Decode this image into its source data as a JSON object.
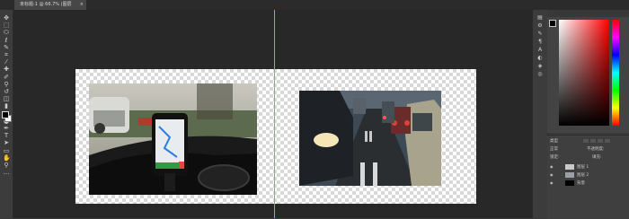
{
  "document": {
    "tab_label": "未标题-1 @ 66.7% (图层",
    "close_glyph": "×"
  },
  "tools": [
    {
      "name": "move-tool-icon",
      "glyph": "✥"
    },
    {
      "name": "artboard-tool-icon",
      "glyph": "⬚"
    },
    {
      "name": "marquee-tool-icon",
      "glyph": "⬭"
    },
    {
      "name": "lasso-tool-icon",
      "glyph": "ℓ"
    },
    {
      "name": "quick-select-tool-icon",
      "glyph": "✎"
    },
    {
      "name": "crop-tool-icon",
      "glyph": "⌗"
    },
    {
      "name": "eyedropper-tool-icon",
      "glyph": "⁄"
    },
    {
      "name": "healing-tool-icon",
      "glyph": "✚"
    },
    {
      "name": "brush-tool-icon",
      "glyph": "✐"
    },
    {
      "name": "stamp-tool-icon",
      "glyph": "⚲"
    },
    {
      "name": "history-brush-icon",
      "glyph": "↺"
    },
    {
      "name": "eraser-tool-icon",
      "glyph": "◫"
    },
    {
      "name": "gradient-tool-icon",
      "glyph": "▮"
    },
    {
      "name": "blur-tool-icon",
      "glyph": "◆"
    },
    {
      "name": "dodge-tool-icon",
      "glyph": "●"
    },
    {
      "name": "pen-tool-icon",
      "glyph": "✒"
    },
    {
      "name": "type-tool-icon",
      "glyph": "T"
    },
    {
      "name": "path-select-tool-icon",
      "glyph": "➤"
    },
    {
      "name": "shape-tool-icon",
      "glyph": "▭"
    },
    {
      "name": "hand-tool-icon",
      "glyph": "✋"
    },
    {
      "name": "zoom-tool-icon",
      "glyph": "⚲"
    },
    {
      "name": "more-tools-icon",
      "glyph": "…"
    }
  ],
  "mini_panels": [
    {
      "name": "history-panel-icon",
      "glyph": "▤"
    },
    {
      "name": "properties-panel-icon",
      "glyph": "⚙"
    },
    {
      "name": "brush-panel-icon",
      "glyph": "✎"
    },
    {
      "name": "paragraph-panel-icon",
      "glyph": "¶"
    },
    {
      "name": "character-panel-icon",
      "glyph": "A"
    },
    {
      "name": "adjust-panel-icon",
      "glyph": "◐"
    },
    {
      "name": "styles-panel-icon",
      "glyph": "◈"
    },
    {
      "name": "channels-panel-icon",
      "glyph": "◎"
    }
  ],
  "layers": {
    "kind_filter": "类型",
    "blend_mode": "正常",
    "opacity_label": "不透明度:",
    "lock_label": "锁定:",
    "fill_label": "填充:",
    "rows": [
      {
        "name": "图层 1"
      },
      {
        "name": "图层 2"
      },
      {
        "name": "背景"
      }
    ]
  },
  "colors": {
    "guide": "#3fc5d6",
    "foreground": "#000000",
    "background": "#ffffff"
  }
}
